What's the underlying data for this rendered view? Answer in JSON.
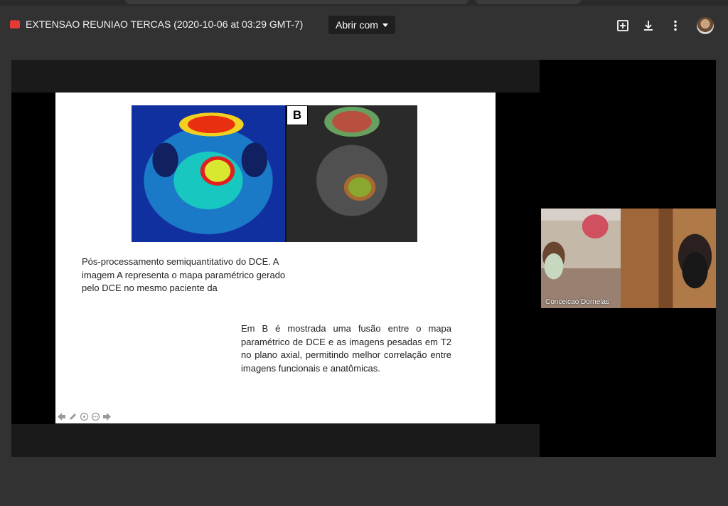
{
  "header": {
    "title": "EXTENSAO REUNIAO TERCAS (2020-10-06 at 03:29 GMT-7)",
    "open_with_label": "Abrir com"
  },
  "slide": {
    "panel_label": "B",
    "caption_a": "Pós-processamento semiquantitativo do DCE. A imagem A representa o mapa paramétrico gerado pelo DCE no mesmo paciente da",
    "caption_b": "Em B é mostrada uma fusão entre o mapa paramétrico de DCE e as imagens pesadas em T2 no plano axial, permitindo melhor correlação entre imagens funcionais e anatômicas."
  },
  "participant": {
    "name": "Conceicao Dornelas"
  },
  "colors": {
    "background": "#323232",
    "stage": "#000000",
    "file_icon": "#e53935"
  }
}
